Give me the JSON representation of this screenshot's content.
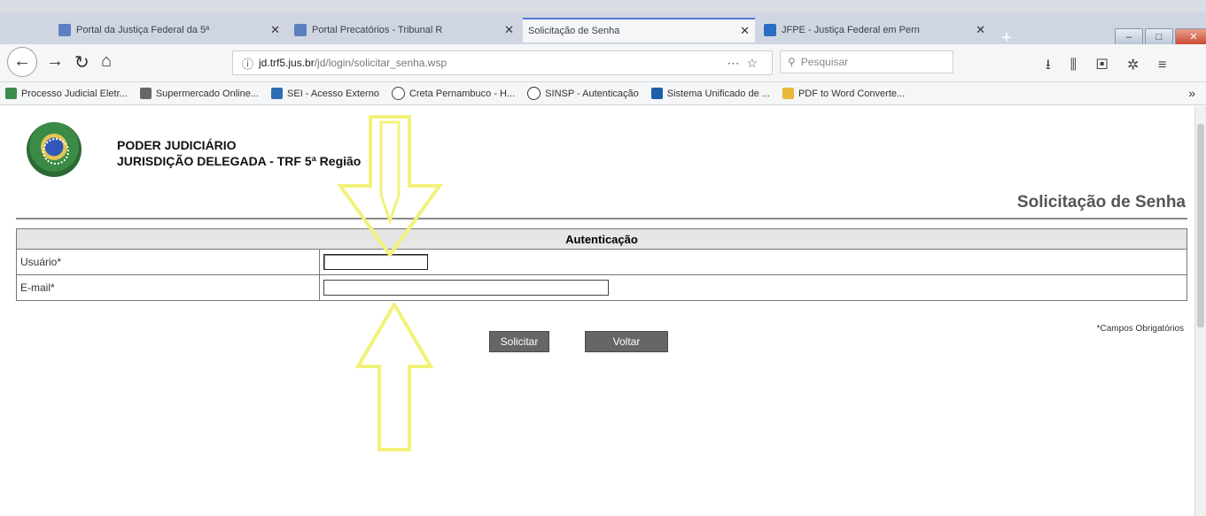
{
  "tabs": [
    {
      "title": "Portal da Justiça Federal da 5ª",
      "active": false
    },
    {
      "title": "Portal Precatórios - Tribunal R",
      "active": false
    },
    {
      "title": "Solicitação de Senha",
      "active": true
    },
    {
      "title": "JFPE - Justiça Federal em Pern",
      "active": false
    }
  ],
  "nav": {
    "url_domain": "jd.trf5.jus.br",
    "url_path": "/jd/login/solicitar_senha.wsp",
    "search_placeholder": "Pesquisar"
  },
  "bookmarks": [
    "Processo Judicial Eletr...",
    "Supermercado Online...",
    "SEI - Acesso Externo",
    "Creta Pernambuco - H...",
    "SINSP - Autenticação",
    "Sistema Unificado de ...",
    "PDF to Word Converte..."
  ],
  "page": {
    "org_line1": "PODER JUDICIÁRIO",
    "org_line2": "JURISDIÇÃO DELEGADA - TRF 5ª Região",
    "title": "Solicitação de Senha",
    "section_header": "Autenticação",
    "fields": [
      {
        "label": "Usuário*",
        "value": ""
      },
      {
        "label": "E-mail*",
        "value": ""
      }
    ],
    "required_note": "*Campos Obrigatórios",
    "submit_label": "Solicitar",
    "back_label": "Voltar"
  },
  "colors": {
    "annotation_arrow": "#f2f27a",
    "button_bg": "#666666"
  }
}
